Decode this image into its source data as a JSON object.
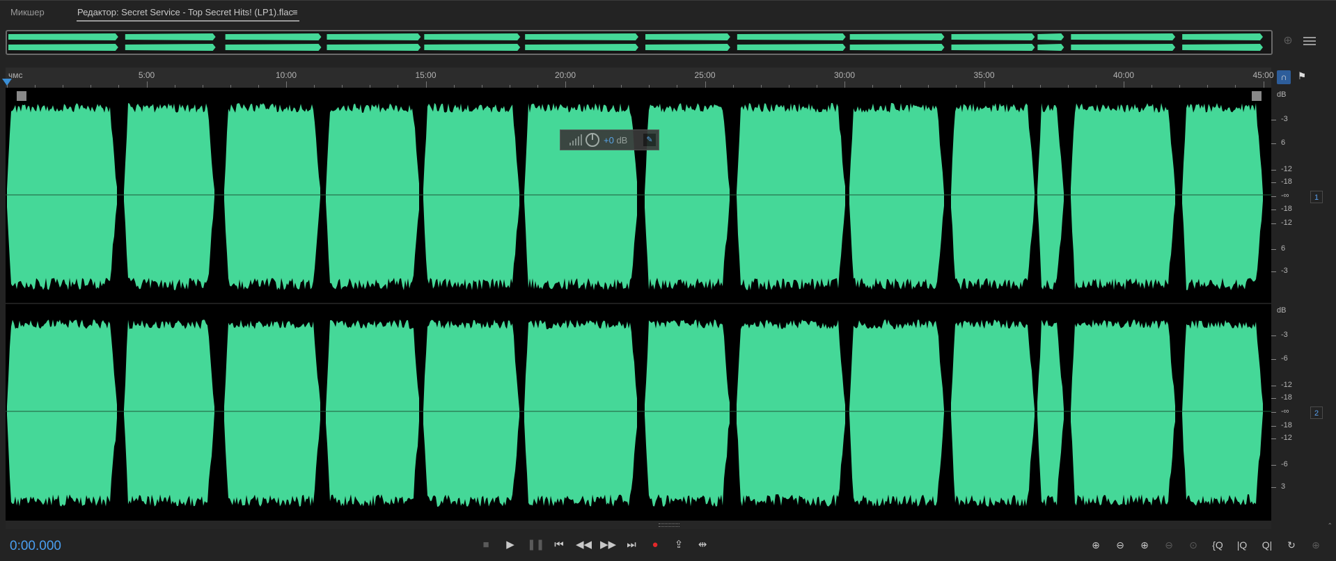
{
  "tabs": {
    "mixer_label": "Микшер",
    "editor_label": "Редактор: Secret Service - Top Secret Hits! (LP1).flac",
    "menu_glyph": "≡"
  },
  "ruler": {
    "unit_label": "чмс",
    "time_labels": [
      "5:00",
      "10:00",
      "15:00",
      "20:00",
      "25:00",
      "30:00",
      "35:00",
      "40:00",
      "45:00"
    ]
  },
  "hud": {
    "value": "+0",
    "unit": "dB"
  },
  "db_scale": {
    "header": "dB",
    "channel1_labels": [
      "-3",
      "6",
      "-12",
      "-18",
      "-∞",
      "-18",
      "-12",
      "6",
      "-3"
    ],
    "channel2_labels": [
      "-3",
      "-6",
      "-12",
      "-18",
      "-∞",
      "-18",
      "-12",
      "-6",
      "3"
    ]
  },
  "channels": [
    "1",
    "2"
  ],
  "transport": {
    "timecode": "0:00.000"
  },
  "colors": {
    "waveform": "#45d898",
    "accent": "#3b8fd6",
    "record": "#e3282a",
    "background": "#232323"
  },
  "icons": {
    "stop": "stop-icon",
    "play": "play-icon",
    "pause": "pause-icon",
    "to_start": "skip-to-start-icon",
    "rewind": "rewind-icon",
    "fast_forward": "fast-forward-icon",
    "to_end": "skip-to-end-icon",
    "record": "record-icon",
    "loop": "loop-playback-icon",
    "skip_selection": "skip-selection-icon"
  }
}
